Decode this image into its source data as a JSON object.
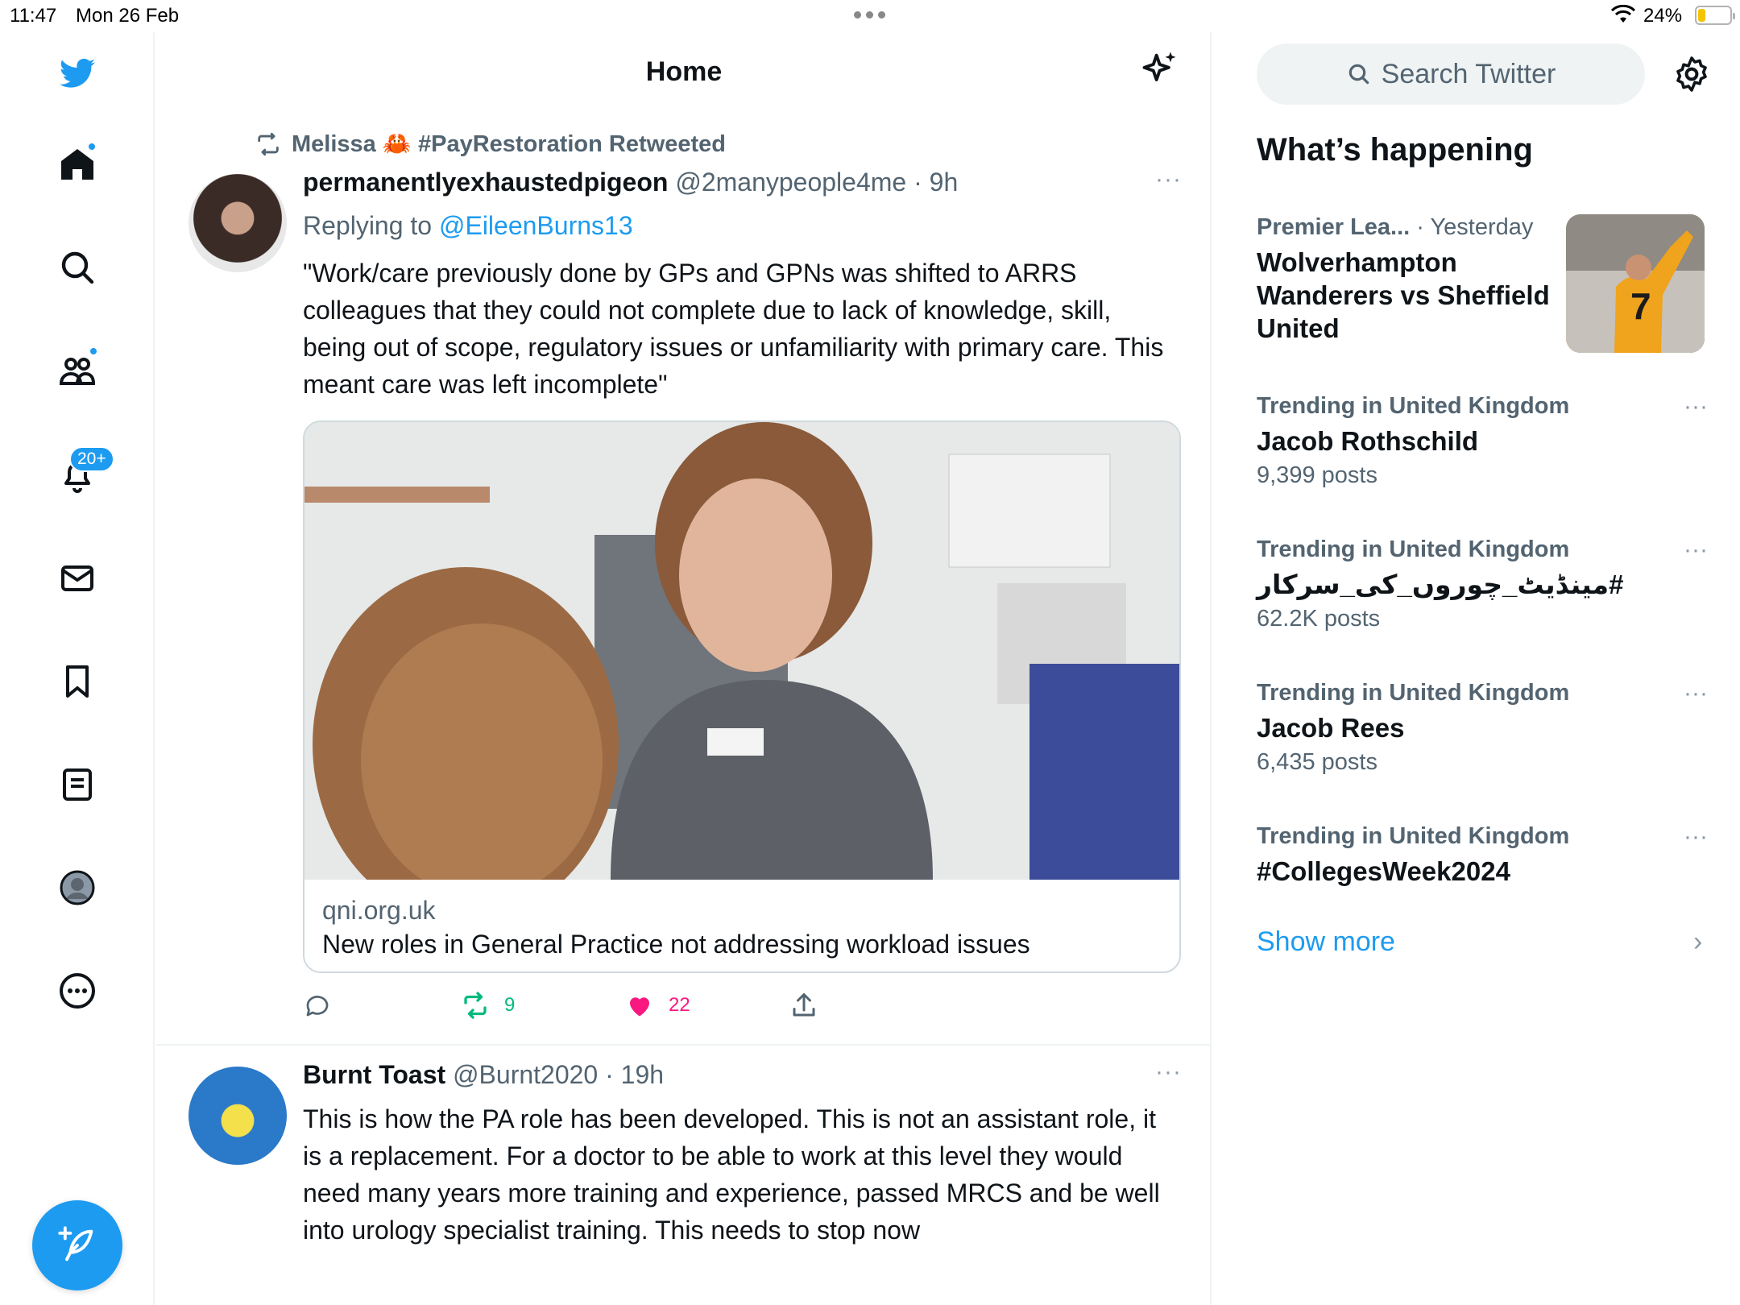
{
  "status_bar": {
    "time": "11:47",
    "date": "Mon 26 Feb",
    "battery": "24%",
    "battery_level": 0.24,
    "battery_color": "#f5c400"
  },
  "nav": {
    "accent": "#1d9bf0",
    "notifications_badge": "20+",
    "items": [
      "twitter-logo-icon",
      "home-icon",
      "search-icon",
      "communities-icon",
      "notifications-icon",
      "messages-icon",
      "bookmarks-icon",
      "lists-icon",
      "profile-icon",
      "more-icon"
    ],
    "compose_icon": "feather-plus-icon"
  },
  "header": {
    "title": "Home",
    "icon": "sparkle-icon"
  },
  "tweets": [
    {
      "retweeted_by": "Melissa 🦀 #PayRestoration Retweeted",
      "name": "permanentlyexhaustedpigeon",
      "handle": "@2manypeople4me",
      "time": "· 9h",
      "replying_label": "Replying to ",
      "replying_to": "@EileenBurns13",
      "text": "\"Work/care previously done by GPs and GPNs was shifted to ARRS colleagues that they could not complete due to lack of knowledge, skill, being out of scope, regulatory issues or unfamiliarity with primary care. This meant care was left incomplete\"",
      "card": {
        "domain": "qni.org.uk",
        "title": "New roles in General Practice not addressing workload issues"
      },
      "actions": {
        "replies": "",
        "retweets": "9",
        "likes": "22"
      },
      "more": "···"
    },
    {
      "name": "Burnt Toast",
      "handle": "@Burnt2020",
      "time": "· 19h",
      "text": "This is how the PA role has been developed. This is not an assistant role, it is a replacement. For a doctor to be able to work at this level they would need many years more training and experience, passed MRCS and be well into urology specialist training. This needs to stop now",
      "more": "···"
    }
  ],
  "sidebar": {
    "search_placeholder": "Search Twitter",
    "whats_happening": "What’s happening",
    "trends": [
      {
        "meta": "Premier Lea...",
        "meta2": "· Yesterday",
        "name": "Wolverhampton Wanderers vs Sheffield United",
        "count": ""
      },
      {
        "meta": "Trending in United Kingdom",
        "name": "Jacob Rothschild",
        "count": "9,399 posts",
        "more": "···"
      },
      {
        "meta": "Trending in United Kingdom",
        "name": "#مینڈیٹ_چوروں_کی_سرکار",
        "count": "62.2K posts",
        "more": "···"
      },
      {
        "meta": "Trending in United Kingdom",
        "name": "Jacob Rees",
        "count": "6,435 posts",
        "more": "···"
      },
      {
        "meta": "Trending in United Kingdom",
        "name": "#CollegesWeek2024",
        "count": "",
        "more": "···"
      }
    ],
    "show_more": "Show more",
    "chevron": "›"
  }
}
